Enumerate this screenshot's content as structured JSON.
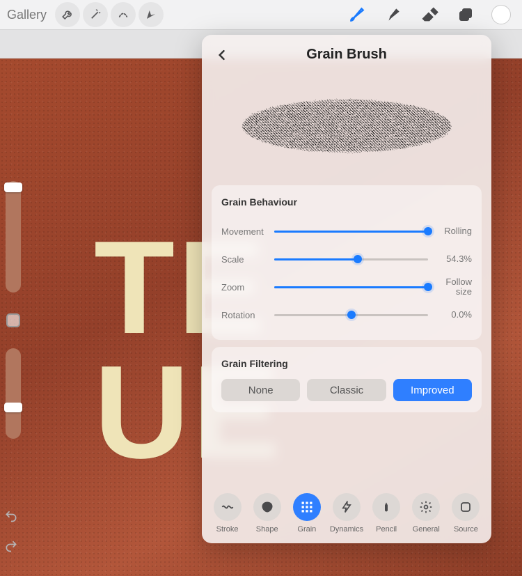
{
  "topbar": {
    "gallery": "Gallery",
    "left_tools": [
      {
        "name": "wrench-icon"
      },
      {
        "name": "wand-icon"
      },
      {
        "name": "select-icon"
      },
      {
        "name": "move-icon"
      }
    ],
    "right_tools": [
      {
        "name": "brush-icon",
        "active": true
      },
      {
        "name": "smudge-icon",
        "active": false
      },
      {
        "name": "eraser-icon",
        "active": false
      },
      {
        "name": "layers-icon",
        "active": false
      }
    ],
    "swatch_color": "#ffffff"
  },
  "canvas": {
    "text_line1": "TE",
    "text_line2": "UE"
  },
  "popover": {
    "title": "Grain Brush",
    "behaviour": {
      "heading": "Grain Behaviour",
      "sliders": [
        {
          "label": "Movement",
          "value_text": "Rolling",
          "percent": 100
        },
        {
          "label": "Scale",
          "value_text": "54.3%",
          "percent": 54.3
        },
        {
          "label": "Zoom",
          "value_text": "Follow size",
          "percent": 100
        },
        {
          "label": "Rotation",
          "value_text": "0.0%",
          "percent": 50,
          "centered": true
        }
      ]
    },
    "filtering": {
      "heading": "Grain Filtering",
      "options": [
        {
          "label": "None",
          "active": false
        },
        {
          "label": "Classic",
          "active": false
        },
        {
          "label": "Improved",
          "active": true
        }
      ]
    },
    "tabs": [
      {
        "label": "Stroke",
        "icon": "wave-icon"
      },
      {
        "label": "Shape",
        "icon": "blob-icon"
      },
      {
        "label": "Grain",
        "icon": "grid-icon",
        "active": true
      },
      {
        "label": "Dynamics",
        "icon": "bolt-icon"
      },
      {
        "label": "Pencil",
        "icon": "pencil-icon"
      },
      {
        "label": "General",
        "icon": "gear-icon"
      },
      {
        "label": "Source",
        "icon": "square-icon"
      }
    ]
  }
}
